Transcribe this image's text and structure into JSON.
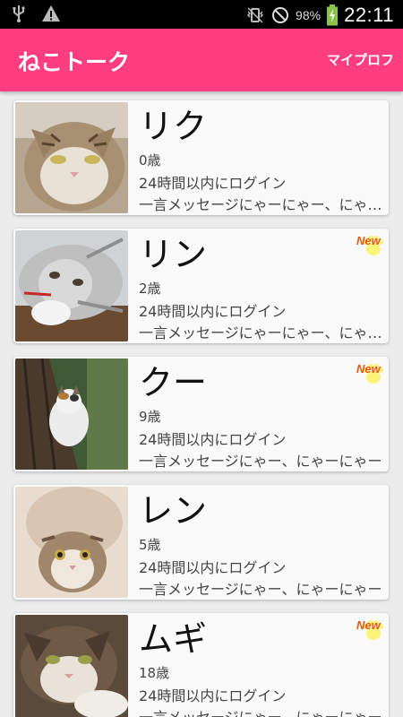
{
  "statusbar": {
    "battery": "98%",
    "time": "22:11",
    "icons": [
      "usb-icon",
      "warning-icon",
      "vibrate-icon",
      "no-signal-icon",
      "battery-charging-icon"
    ]
  },
  "appbar": {
    "title": "ねこトーク",
    "profile_label": "マイプロフ",
    "color": "#ff3d7f"
  },
  "new_label": "New",
  "cats": [
    {
      "name": "リク",
      "age": "0歳",
      "login": "24時間以内にログイン",
      "message": "一言メッセージにゃーにゃー、にゃーにゃー",
      "is_new": false
    },
    {
      "name": "リン",
      "age": "2歳",
      "login": "24時間以内にログイン",
      "message": "一言メッセージにゃーにゃー、にゃーにゃー",
      "is_new": true
    },
    {
      "name": "クー",
      "age": "9歳",
      "login": "24時間以内にログイン",
      "message": "一言メッセージにゃー、にゃーにゃー",
      "is_new": true
    },
    {
      "name": "レン",
      "age": "5歳",
      "login": "24時間以内にログイン",
      "message": "一言メッセージにゃー、にゃーにゃー",
      "is_new": false
    },
    {
      "name": "ムギ",
      "age": "18歳",
      "login": "24時間以内にログイン",
      "message": "一言メッセージにゃー、にゃーにゃー",
      "is_new": true
    }
  ]
}
